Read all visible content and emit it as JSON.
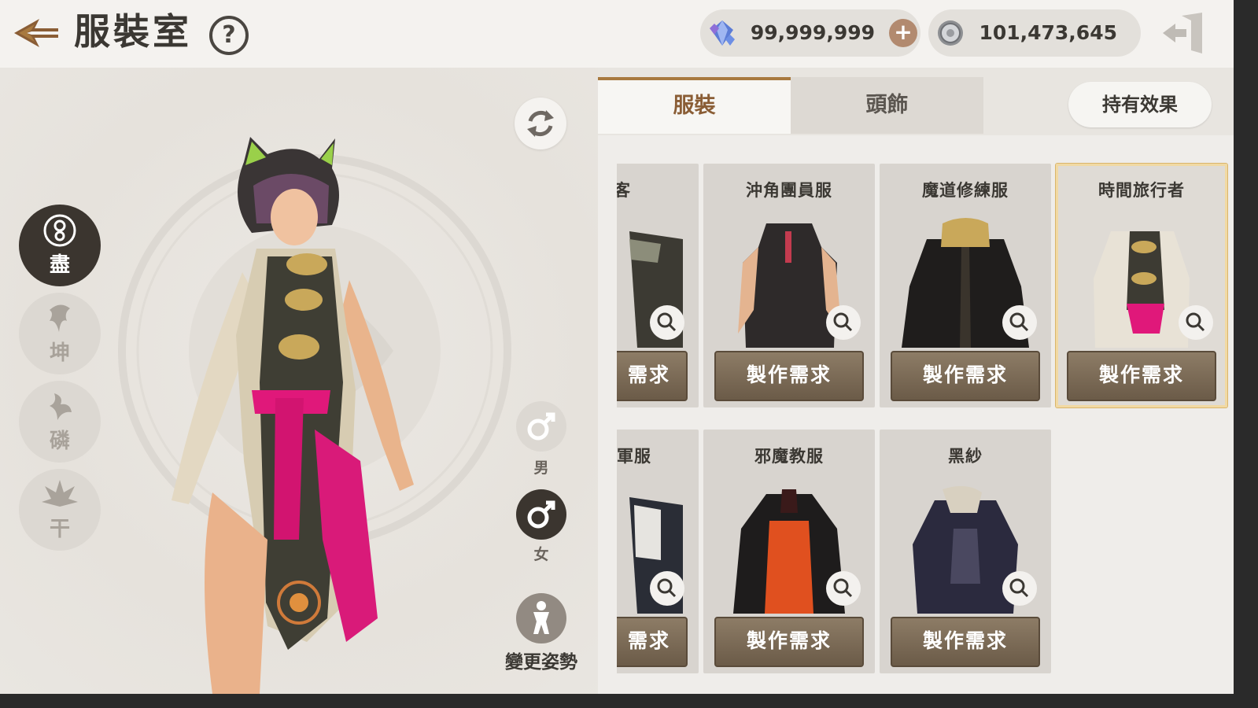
{
  "header": {
    "title": "服裝室",
    "help_label": "?",
    "gem_amount": "99,999,999",
    "plus_label": "+",
    "coin_amount": "101,473,645"
  },
  "classes": [
    {
      "label": "盡",
      "icon": "swirl-emblem-icon",
      "active": true
    },
    {
      "label": "坤",
      "icon": "tree-emblem-icon",
      "active": false
    },
    {
      "label": "磷",
      "icon": "bird-emblem-icon",
      "active": false
    },
    {
      "label": "干",
      "icon": "lotus-emblem-icon",
      "active": false
    }
  ],
  "gender": {
    "male_label": "男",
    "female_label": "女",
    "selected": "female"
  },
  "pose": {
    "label": "變更姿勢"
  },
  "tabs": {
    "costume": "服裝",
    "headwear": "頭飾",
    "active": "costume"
  },
  "effect_button": "持有效果",
  "costumes": [
    {
      "name": "客",
      "button": "需求",
      "partial": true
    },
    {
      "name": "沖角團員服",
      "button": "製作需求"
    },
    {
      "name": "魔道修練服",
      "button": "製作需求"
    },
    {
      "name": "時間旅行者",
      "button": "製作需求",
      "selected": true
    },
    {
      "name": "軍服",
      "button": "需求",
      "partial": true
    },
    {
      "name": "邪魔教服",
      "button": "製作需求"
    },
    {
      "name": "黑紗",
      "button": "製作需求"
    }
  ],
  "colors": {
    "accent": "#a8793f",
    "button": "#7a6a56",
    "dark": "#3b352f"
  }
}
